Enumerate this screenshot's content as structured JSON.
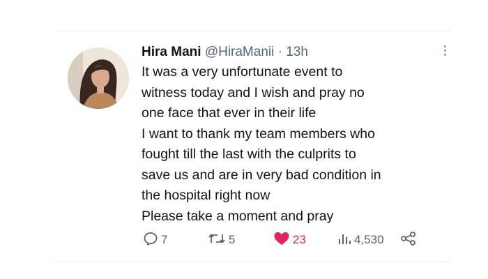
{
  "tweet": {
    "author_name": "Hira Mani",
    "handle": "@HiraManii",
    "separator": "·",
    "time": "13h",
    "lines": [
      "It was a very unfortunate event to",
      "witness today and I wish and pray no",
      "one face that ever in their life",
      "I want to thank my team members who",
      "fought till the last with the culprits to",
      "save us and are in very bad condition in",
      "the hospital right now",
      "Please take a moment and pray"
    ]
  },
  "actions": {
    "reply": {
      "icon": "reply-icon",
      "count": "7"
    },
    "retweet": {
      "icon": "retweet-icon",
      "count": "5"
    },
    "like": {
      "icon": "heart-icon",
      "count": "23",
      "liked": true,
      "color": "#e0245e"
    },
    "views": {
      "icon": "views-icon",
      "count": "4,530"
    },
    "share": {
      "icon": "share-icon"
    }
  },
  "colors": {
    "text": "#0f1419",
    "muted": "#536471",
    "like": "#e0245e"
  }
}
